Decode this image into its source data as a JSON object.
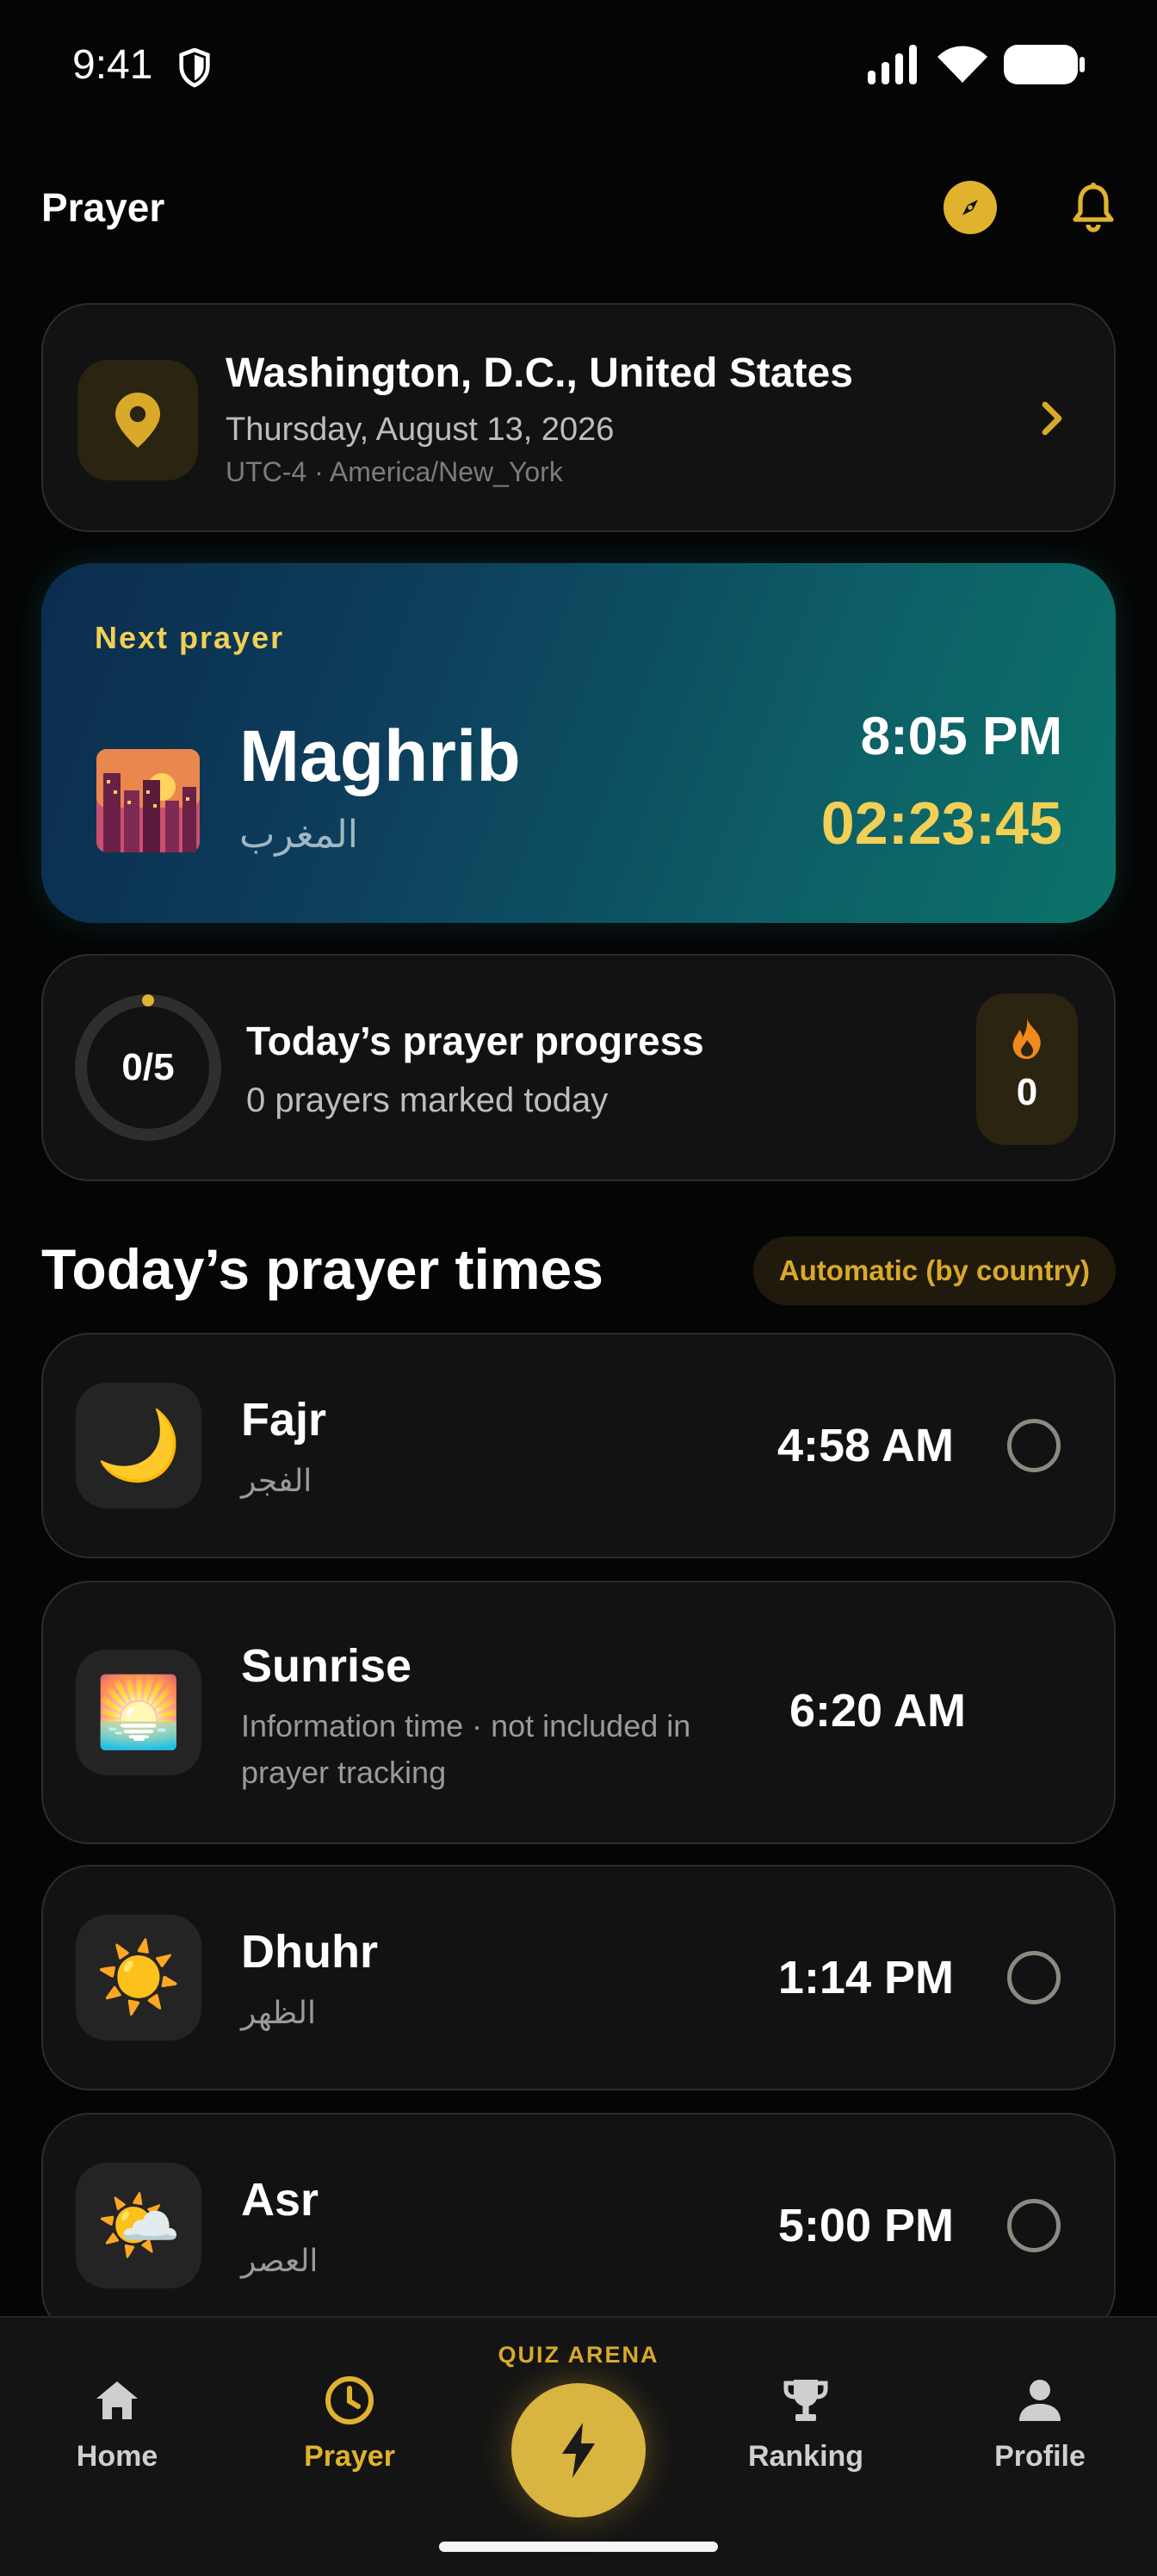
{
  "status_bar": {
    "time": "9:41"
  },
  "header": {
    "title": "Prayer"
  },
  "location": {
    "city": "Washington, D.C., United States",
    "date": "Thursday, August 13, 2026",
    "timezone": "UTC-4 · America/New_York"
  },
  "next_prayer": {
    "label": "Next prayer",
    "name": "Maghrib",
    "arabic": "المغرب",
    "emoji": "🌇",
    "time": "8:05 PM",
    "countdown": "02:23:45"
  },
  "progress": {
    "ring_text": "0/5",
    "completed_fraction": 0,
    "title": "Today’s prayer progress",
    "subtitle": "0 prayers marked today",
    "streak": "0"
  },
  "section": {
    "title": "Today’s prayer times",
    "method": "Automatic (by country)"
  },
  "prayers": [
    {
      "name": "Fajr",
      "arabic": "الفجر",
      "emoji": "🌙",
      "time": "4:58 AM",
      "checked": false
    },
    {
      "name": "Sunrise",
      "note": "Information time · not included in prayer tracking",
      "emoji": "🌅",
      "time": "6:20 AM"
    },
    {
      "name": "Dhuhr",
      "arabic": "الظهر",
      "emoji": "☀️",
      "time": "1:14 PM",
      "checked": false
    },
    {
      "name": "Asr",
      "arabic": "العصر",
      "emoji": "🌤️",
      "time": "5:00 PM",
      "checked": false
    }
  ],
  "nav": {
    "home": "Home",
    "prayer": "Prayer",
    "quiz": "QUIZ ARENA",
    "ranking": "Ranking",
    "profile": "Profile"
  },
  "colors": {
    "accent": "#E0B22E",
    "background": "#050505",
    "card": "#121212"
  }
}
